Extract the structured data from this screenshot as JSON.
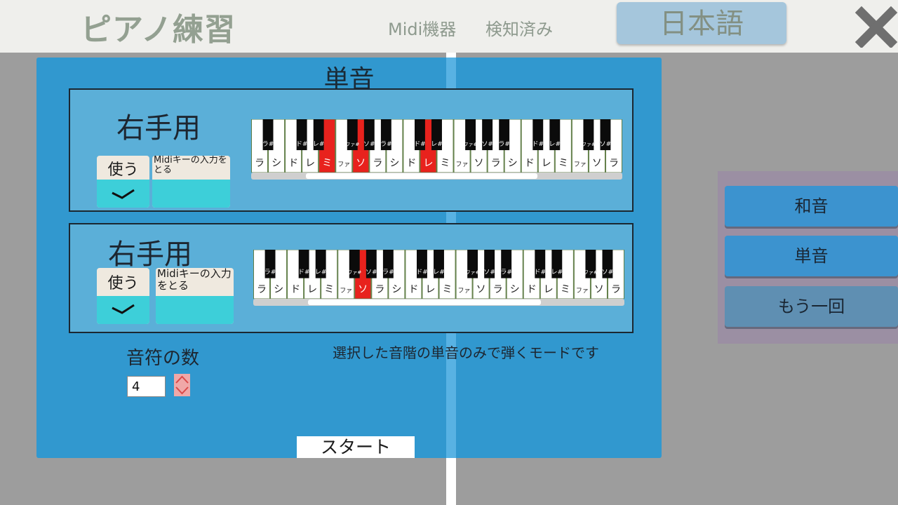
{
  "header": {
    "title": "ピアノ練習",
    "midi_label": "Midi機器",
    "midi_status": "検知済み",
    "language_button": "日本語",
    "close_icon": "close-icon"
  },
  "panel": {
    "title": "単音",
    "sections": [
      {
        "hand_label": "右手用",
        "use_label": "使う",
        "use_checked": true,
        "midi_button_label": "Midiキーの入力をとる",
        "white_keys": [
          "ラ",
          "シ",
          "ド",
          "レ",
          "ミ",
          "ファ",
          "ソ",
          "ラ",
          "シ",
          "ド",
          "レ",
          "ミ",
          "ファ",
          "ソ",
          "ラ",
          "シ",
          "ド",
          "レ",
          "ミ",
          "ファ",
          "ソ",
          "ラ"
        ],
        "black_keys": [
          "ラ#",
          "",
          "ド#",
          "レ#",
          "",
          "ファ#",
          "ソ#",
          "ラ#",
          "",
          "ド#",
          "レ#",
          "",
          "ファ#",
          "ソ#",
          "ラ#",
          "",
          "ド#",
          "レ#",
          "",
          "ファ#",
          "ソ#"
        ],
        "highlighted_keys": [
          "ミ",
          "ソ",
          "レ"
        ]
      },
      {
        "hand_label": "右手用",
        "use_label": "使う",
        "use_checked": true,
        "midi_button_label": "Midiキーの入力をとる",
        "white_keys": [
          "ラ",
          "シ",
          "ド",
          "レ",
          "ミ",
          "ファ",
          "ソ",
          "ラ",
          "シ",
          "ド",
          "レ",
          "ミ",
          "ファ",
          "ソ",
          "ラ",
          "シ",
          "ド",
          "レ",
          "ミ",
          "ファ",
          "ソ",
          "ラ"
        ],
        "black_keys": [
          "ラ#",
          "",
          "ド#",
          "レ#",
          "",
          "ファ#",
          "ソ#",
          "ラ#",
          "",
          "ド#",
          "レ#",
          "",
          "ファ#",
          "ソ#",
          "ラ#",
          "",
          "ド#",
          "レ#",
          "",
          "ファ#",
          "ソ#"
        ],
        "highlighted_keys": [
          "ソ"
        ]
      }
    ],
    "note_count_label": "音符の数",
    "note_count_value": "4",
    "description": "選択した音階の単音のみで弾くモードです",
    "start_button": "スタート"
  },
  "side": {
    "buttons": [
      "和音",
      "単音",
      "もう一回"
    ],
    "active_index": 1
  },
  "colors": {
    "panel_bg": "#3198cf",
    "section_bg": "#5bafd8",
    "highlight_key": "#e8221d",
    "check_fill": "#3dcfd9"
  }
}
